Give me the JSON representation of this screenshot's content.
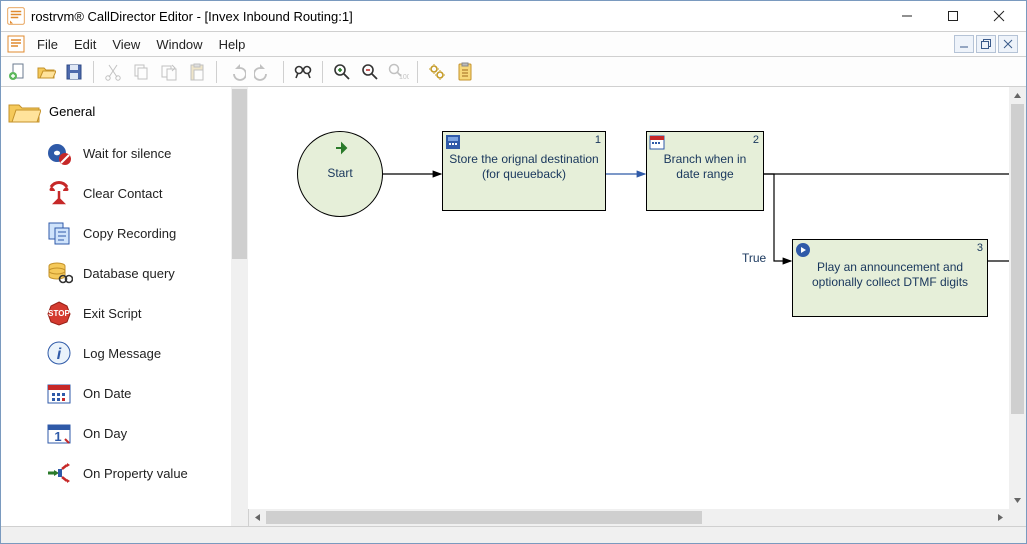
{
  "window": {
    "title": "rostrvm® CallDirector Editor - [Invex Inbound Routing:1]"
  },
  "menu": {
    "items": [
      "File",
      "Edit",
      "View",
      "Window",
      "Help"
    ]
  },
  "toolbar": {
    "items": [
      {
        "name": "new",
        "enabled": true
      },
      {
        "name": "open",
        "enabled": true
      },
      {
        "name": "save",
        "enabled": true
      },
      {
        "sep": true
      },
      {
        "name": "cut",
        "enabled": false
      },
      {
        "name": "copy",
        "enabled": false
      },
      {
        "name": "copyspecial",
        "enabled": false
      },
      {
        "name": "paste",
        "enabled": false
      },
      {
        "sep": true
      },
      {
        "name": "undo",
        "enabled": false
      },
      {
        "name": "redo",
        "enabled": false
      },
      {
        "sep": true
      },
      {
        "name": "find",
        "enabled": true
      },
      {
        "sep": true
      },
      {
        "name": "zoom-in",
        "enabled": true
      },
      {
        "name": "zoom-out",
        "enabled": true
      },
      {
        "name": "zoom-100",
        "enabled": false
      },
      {
        "sep": true
      },
      {
        "name": "settings",
        "enabled": true
      },
      {
        "name": "tasks",
        "enabled": true
      }
    ]
  },
  "tree": {
    "group": "General",
    "items": [
      {
        "id": "wait-silence",
        "label": "Wait for silence",
        "icon": "wait-silence-icon"
      },
      {
        "id": "clear-contact",
        "label": "Clear Contact",
        "icon": "clear-contact-icon"
      },
      {
        "id": "copy-recording",
        "label": "Copy Recording",
        "icon": "copy-recording-icon"
      },
      {
        "id": "database-query",
        "label": "Database query",
        "icon": "database-query-icon"
      },
      {
        "id": "exit-script",
        "label": "Exit Script",
        "icon": "exit-script-icon"
      },
      {
        "id": "log-message",
        "label": "Log Message",
        "icon": "log-message-icon"
      },
      {
        "id": "on-date",
        "label": "On Date",
        "icon": "on-date-icon"
      },
      {
        "id": "on-day",
        "label": "On Day",
        "icon": "on-day-icon"
      },
      {
        "id": "on-property",
        "label": "On Property value",
        "icon": "on-property-icon"
      }
    ]
  },
  "flow": {
    "start": {
      "label": "Start"
    },
    "nodes": [
      {
        "id": 1,
        "label": "Store the orignal destination (for queueback)",
        "icon": "store-icon"
      },
      {
        "id": 2,
        "label": "Branch when in date range",
        "icon": "date-icon"
      },
      {
        "id": 3,
        "label": "Play an announcement and optionally collect DTMF digits",
        "icon": "play-icon"
      }
    ],
    "labels": {
      "true": "True"
    }
  }
}
